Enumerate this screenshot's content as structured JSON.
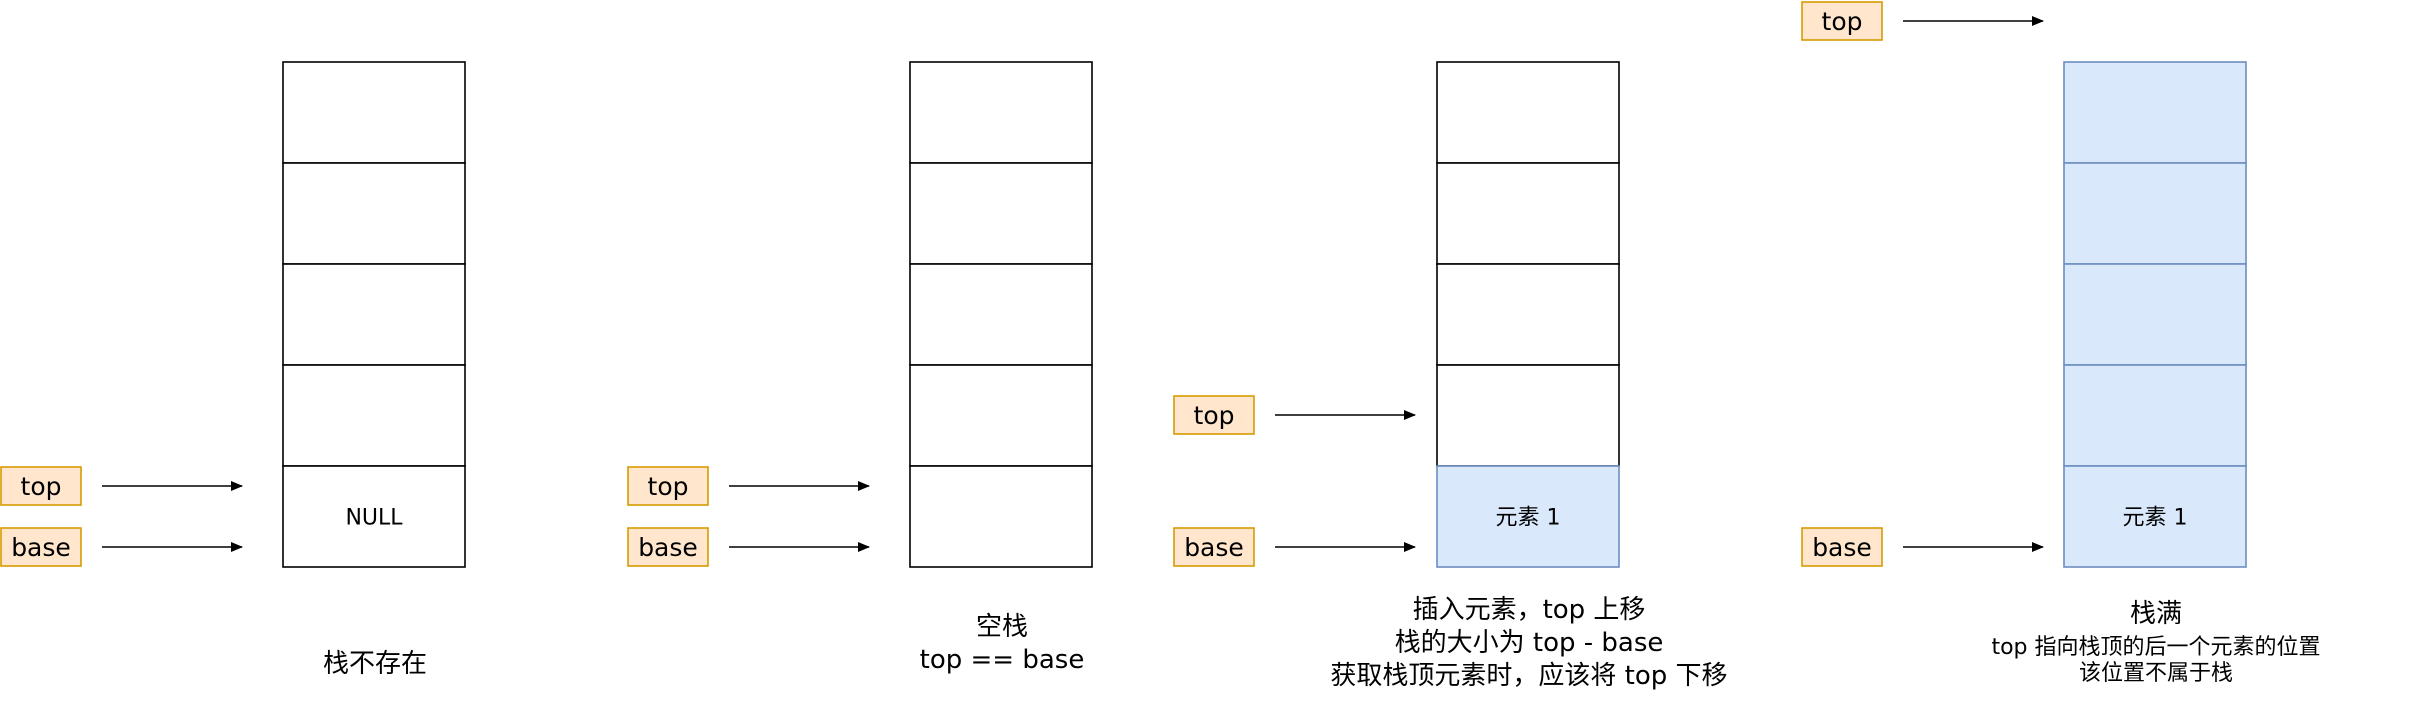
{
  "diagrams": [
    {
      "cells": [
        "",
        "",
        "",
        "",
        "NULL"
      ],
      "filled": [
        false,
        false,
        false,
        false,
        false
      ],
      "pointers": [
        {
          "label": "top",
          "target": "slot-5"
        },
        {
          "label": "base",
          "target": "base"
        }
      ],
      "caption": [
        "栈不存在"
      ]
    },
    {
      "cells": [
        "",
        "",
        "",
        "",
        ""
      ],
      "filled": [
        false,
        false,
        false,
        false,
        false
      ],
      "pointers": [
        {
          "label": "top",
          "target": "slot-5"
        },
        {
          "label": "base",
          "target": "base"
        }
      ],
      "caption": [
        "空栈",
        "top == base"
      ]
    },
    {
      "cells": [
        "",
        "",
        "",
        "",
        "元素 1"
      ],
      "filled": [
        false,
        false,
        false,
        false,
        true
      ],
      "pointers": [
        {
          "label": "top",
          "target": "slot-4"
        },
        {
          "label": "base",
          "target": "base"
        }
      ],
      "caption": [
        "插入元素，top 上移",
        "栈的大小为 top - base",
        "获取栈顶元素时，应该将 top 下移"
      ]
    },
    {
      "cells": [
        "",
        "",
        "",
        "",
        "元素 1"
      ],
      "filled": [
        true,
        true,
        true,
        true,
        true
      ],
      "pointers": [
        {
          "label": "top",
          "target": "above-stack"
        },
        {
          "label": "base",
          "target": "base"
        }
      ],
      "caption": [
        "栈满",
        "top 指向栈顶的后一个元素的位置",
        "该位置不属于栈"
      ]
    }
  ],
  "colors": {
    "pointer_fill": "#ffe6cc",
    "pointer_stroke": "#d79b00",
    "filled_cell": "#dae8fc",
    "filled_stroke": "#6c8ebf",
    "empty_stroke": "#000000"
  }
}
